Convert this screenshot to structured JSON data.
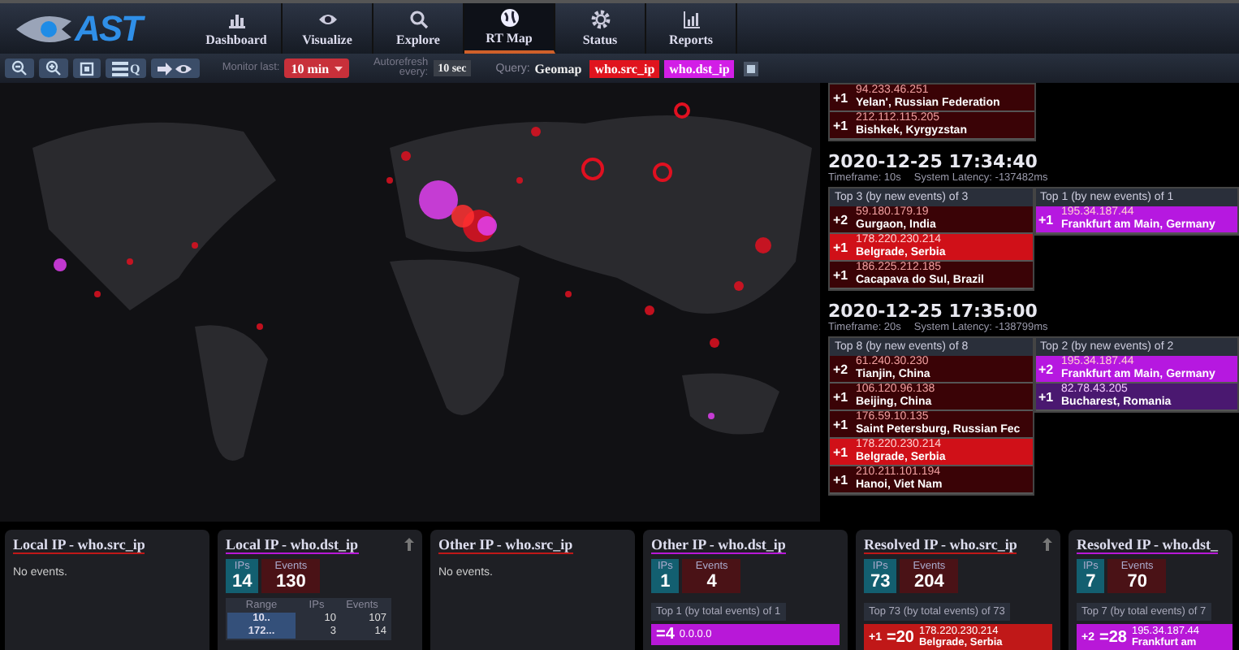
{
  "nav": {
    "logo": "AST",
    "tabs": [
      {
        "label": "Dashboard",
        "kind": "dashboard",
        "selected": false
      },
      {
        "label": "Visualize",
        "kind": "visualize",
        "selected": false
      },
      {
        "label": "Explore",
        "kind": "explore",
        "selected": false
      },
      {
        "label": "RT Map",
        "kind": "map",
        "selected": true
      },
      {
        "label": "Status",
        "kind": "status",
        "selected": false
      },
      {
        "label": "Reports",
        "kind": "reports",
        "selected": false
      }
    ]
  },
  "toolbar": {
    "db_button": "Q",
    "monitor_label": "Monitor last:",
    "monitor_value": "10 min",
    "autorefresh_label": "Autorefresh every:",
    "autorefresh_value": "10 sec",
    "query_label": "Query:",
    "query_name": "Geomap",
    "query_tags": [
      {
        "label": "who.src_ip",
        "color": "#e0141e"
      },
      {
        "label": "who.dst_ip",
        "color": "#d21ee6"
      }
    ]
  },
  "feed": {
    "partial_table": {
      "kind": "src",
      "rows": [
        {
          "count": "+1",
          "ip": "94.233.46.251",
          "place": "Yelan', Russian Federation",
          "highlight": false
        },
        {
          "count": "+1",
          "ip": "212.112.115.205",
          "place": "Bishkek, Kyrgyzstan",
          "highlight": false
        }
      ]
    },
    "snapshots": [
      {
        "time": "2020-12-25 17:34:40",
        "timeframe": "Timeframe: 10s",
        "latency": "System Latency: -137482ms",
        "tables": [
          {
            "kind": "src",
            "title": "Top 3 (by new events) of 3",
            "rows": [
              {
                "count": "+2",
                "ip": "59.180.179.19",
                "place": "Gurgaon, India",
                "highlight": false
              },
              {
                "count": "+1",
                "ip": "178.220.230.214",
                "place": "Belgrade, Serbia",
                "highlight": true
              },
              {
                "count": "+1",
                "ip": "186.225.212.185",
                "place": "Cacapava do Sul, Brazil",
                "highlight": false
              }
            ]
          },
          {
            "kind": "dst",
            "title": "Top 1 (by new events) of 1",
            "rows": [
              {
                "count": "+1",
                "ip": "195.34.187.44",
                "place": "Frankfurt am Main, Germany",
                "highlight": true
              }
            ]
          }
        ]
      },
      {
        "time": "2020-12-25 17:35:00",
        "timeframe": "Timeframe: 20s",
        "latency": "System Latency: -138799ms",
        "tables": [
          {
            "kind": "src",
            "title": "Top 8 (by new events) of 8",
            "rows": [
              {
                "count": "+2",
                "ip": "61.240.30.230",
                "place": "Tianjin, China",
                "highlight": false
              },
              {
                "count": "+1",
                "ip": "106.120.96.138",
                "place": "Beijing, China",
                "highlight": false
              },
              {
                "count": "+1",
                "ip": "176.59.10.135",
                "place": "Saint Petersburg, Russian Fec",
                "highlight": false
              },
              {
                "count": "+1",
                "ip": "178.220.230.214",
                "place": "Belgrade, Serbia",
                "highlight": true
              },
              {
                "count": "+1",
                "ip": "210.211.101.194",
                "place": "Hanoi, Viet Nam",
                "highlight": false
              }
            ]
          },
          {
            "kind": "dst",
            "title": "Top 2 (by new events) of 2",
            "rows": [
              {
                "count": "+2",
                "ip": "195.34.187.44",
                "place": "Frankfurt am Main, Germany",
                "highlight": true
              },
              {
                "count": "+1",
                "ip": "82.78.43.205",
                "place": "Bucharest, Romania",
                "highlight": false
              }
            ]
          }
        ]
      }
    ]
  },
  "panels": [
    {
      "kind": "empty",
      "title": "Local IP - who.src_ip",
      "color": "#c01818",
      "scrollable": false,
      "message": "No events."
    },
    {
      "kind": "ranges",
      "title": "Local IP - who.dst_ip",
      "color": "#b818d8",
      "scrollable": true,
      "ips_label": "IPs",
      "ips": "14",
      "events_label": "Events",
      "events": "130",
      "columns": [
        "Range",
        "IPs",
        "Events"
      ],
      "rows": [
        [
          "10..",
          "10",
          "107"
        ],
        [
          "172...",
          "3",
          "14"
        ]
      ]
    },
    {
      "kind": "empty",
      "title": "Other IP - who.src_ip",
      "color": "#c01818",
      "scrollable": false,
      "message": "No events."
    },
    {
      "kind": "top",
      "title": "Other IP - who.dst_ip",
      "color": "#b818d8",
      "scrollable": false,
      "ips_label": "IPs",
      "ips": "1",
      "events_label": "Events",
      "events": "4",
      "top_label": "Top 1 (by total events) of 1",
      "rows": [
        {
          "total": "=4",
          "ip": "0.0.0.0"
        }
      ]
    },
    {
      "kind": "top",
      "title": "Resolved IP - who.src_ip",
      "color": "#c01818",
      "scrollable": true,
      "ips_label": "IPs",
      "ips": "73",
      "events_label": "Events",
      "events": "204",
      "top_label": "Top 73 (by total events) of 73",
      "rows": [
        {
          "delta": "+1",
          "total": "=20",
          "ip": "178.220.230.214",
          "place": "Belgrade, Serbia"
        }
      ]
    },
    {
      "kind": "top",
      "title": "Resolved IP - who.dst_",
      "color": "#b818d8",
      "scrollable": false,
      "ips_label": "IPs",
      "ips": "7",
      "events_label": "Events",
      "events": "70",
      "top_label": "Top 7 (by total events) of 7",
      "rows": [
        {
          "delta": "+2",
          "total": "=28",
          "ip": "195.34.187.44",
          "place": "Frankfurt am"
        }
      ]
    }
  ]
}
